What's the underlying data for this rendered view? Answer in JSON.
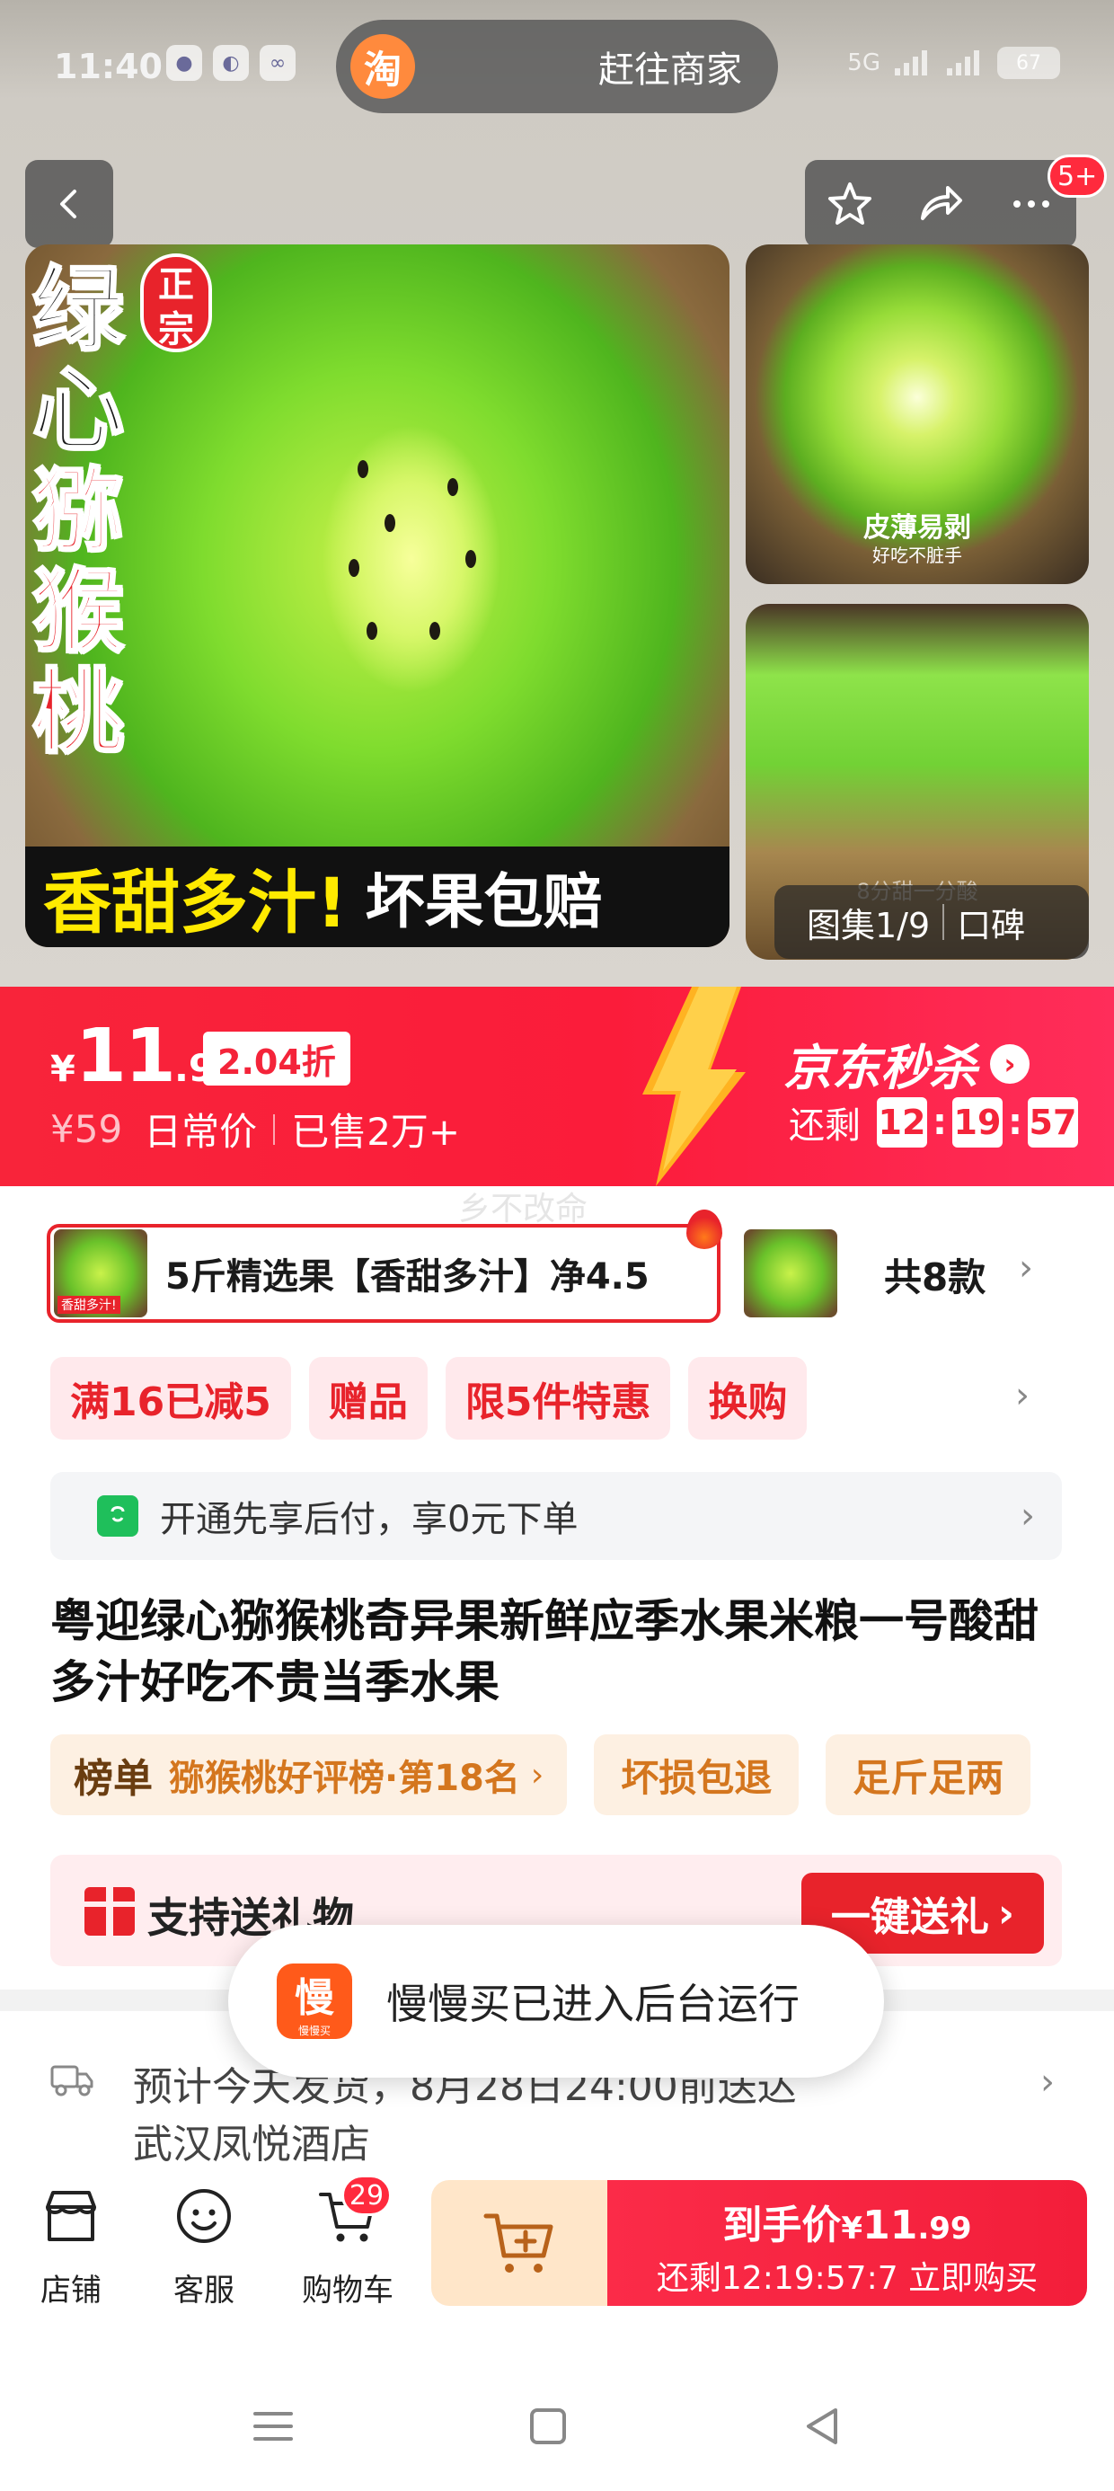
{
  "status_bar": {
    "time": "11:40",
    "network": "5G",
    "battery": "67"
  },
  "top_pill": {
    "logo": "淘",
    "label": "赶往商家"
  },
  "gallery": {
    "badge_count": "5+",
    "main_image_text": {
      "vertical_title_black": "绿心",
      "vertical_title_red": "猕猴桃",
      "corner_tag": "正宗",
      "banner_yellow": "香甜多汁!",
      "banner_white": "坏果包赔"
    },
    "thumb1_caption": "皮薄易剥",
    "thumb1_subcaption": "好吃不脏手",
    "thumb2_caption": "8分甜一分酸",
    "counter": "图集1/9",
    "reviews_label": "口碑"
  },
  "price": {
    "currency": "¥",
    "integer": "11",
    "decimal": ".99",
    "discount": "2.04折",
    "original": "¥59",
    "original_label": "日常价",
    "sold": "已售2万+",
    "seckill_title": "京东秒杀",
    "countdown_label": "还剩",
    "countdown_h": "12",
    "countdown_m": "19",
    "countdown_s": "57"
  },
  "watermark": "乡不改命",
  "sku": {
    "selected_label": "5斤精选果【香甜多汁】净4.5",
    "thumb_label": "香甜多汁!坏果包赔",
    "count_label": "共8款"
  },
  "promos": [
    {
      "label": "满16已减5"
    },
    {
      "label": "赠品"
    },
    {
      "label": "限5件特惠"
    },
    {
      "label": "换购"
    }
  ],
  "paylater": {
    "text": "开通先享后付，享0元下单"
  },
  "product": {
    "title": "粤迎绿心猕猴桃奇异果新鲜应季水果米粮一号酸甜多汁好吃不贵当季水果"
  },
  "tags": {
    "rank_label": "榜单",
    "rank_value": "猕猴桃好评榜·第18名",
    "tag1": "坏损包退",
    "tag2": "足斤足两"
  },
  "gift": {
    "text": "支持送礼物",
    "button": "一键送礼"
  },
  "delivery": {
    "line1": "预计今天发货，8月28日24:00前送达",
    "line2": "武汉凤悦酒店"
  },
  "toast": {
    "logo_main": "慢",
    "logo_sub": "慢慢买",
    "text": "慢慢买已进入后台运行"
  },
  "bottom_bar": {
    "shop": "店铺",
    "service": "客服",
    "cart": "购物车",
    "cart_count": "29",
    "buy_line1_prefix": "到手价",
    "buy_currency": "¥",
    "buy_int": "11",
    "buy_dec": ".99",
    "buy_line2": "还剩12:19:57:7  立即购买"
  },
  "colors": {
    "jd_red": "#f4243a",
    "promo_bg": "#ffe9ec",
    "rank_bg": "#fdf0e2",
    "rank_text": "#d4761e",
    "kiwi_green": "#7fdc2e"
  }
}
